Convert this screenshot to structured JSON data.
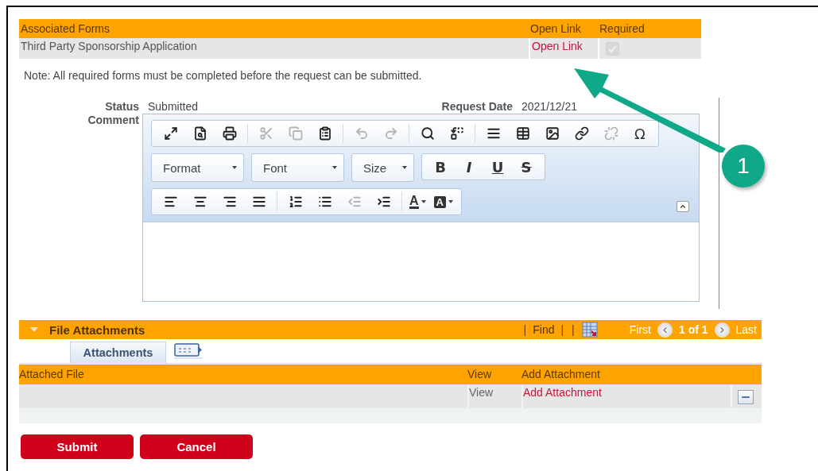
{
  "associated_forms": {
    "columns": [
      "Associated Forms",
      "Open Link",
      "Required"
    ],
    "rows": [
      {
        "name": "Third Party Sponsorship Application",
        "link": "Open Link",
        "required": true,
        "disabled": true
      }
    ]
  },
  "note": "Note: All required forms must be completed before the request can be submitted.",
  "status": {
    "label": "Status",
    "value": "Submitted"
  },
  "request_date": {
    "label": "Request Date",
    "value": "2021/12/21"
  },
  "comment": {
    "label": "Comment",
    "toolbar_rows": [
      [
        {
          "kind": "maximize",
          "disabled": false
        },
        {
          "kind": "preview",
          "disabled": false
        },
        {
          "kind": "print",
          "disabled": false
        },
        {
          "kind": "sep"
        },
        {
          "kind": "cut",
          "disabled": true
        },
        {
          "kind": "copy",
          "disabled": true
        },
        {
          "kind": "paste",
          "disabled": false
        },
        {
          "kind": "sep"
        },
        {
          "kind": "undo",
          "disabled": true
        },
        {
          "kind": "redo",
          "disabled": true
        },
        {
          "kind": "sep"
        },
        {
          "kind": "find",
          "disabled": false
        },
        {
          "kind": "replace",
          "disabled": false
        },
        {
          "kind": "sep"
        },
        {
          "kind": "rule",
          "disabled": false
        },
        {
          "kind": "table",
          "disabled": false
        },
        {
          "kind": "image",
          "disabled": false
        },
        {
          "kind": "link",
          "disabled": false
        },
        {
          "kind": "unlink",
          "disabled": true
        },
        {
          "kind": "glyph",
          "text": "Ω",
          "disabled": false
        }
      ],
      [
        {
          "kind": "combo",
          "text": "Format"
        },
        {
          "kind": "combo",
          "text": "Font"
        },
        {
          "kind": "combo",
          "text": "Size"
        },
        {
          "kind": "bold",
          "text": "B",
          "disabled": false
        },
        {
          "kind": "italic",
          "text": "I",
          "disabled": false
        },
        {
          "kind": "underline",
          "text": "U",
          "disabled": false
        },
        {
          "kind": "strike",
          "text": "S",
          "disabled": false
        }
      ],
      [
        {
          "kind": "align-left",
          "disabled": false
        },
        {
          "kind": "align-center",
          "disabled": false
        },
        {
          "kind": "align-right",
          "disabled": false
        },
        {
          "kind": "justify",
          "disabled": false
        },
        {
          "kind": "sep"
        },
        {
          "kind": "numbered",
          "disabled": false
        },
        {
          "kind": "bulleted",
          "disabled": false
        },
        {
          "kind": "outdent",
          "disabled": true
        },
        {
          "kind": "indent",
          "disabled": false
        },
        {
          "kind": "sep"
        },
        {
          "kind": "text-color",
          "text": "A",
          "disabled": false
        },
        {
          "kind": "back-color",
          "text": "A",
          "disabled": false
        }
      ]
    ]
  },
  "file_attachments": {
    "title": "File Attachments",
    "expanded": true,
    "nav": [
      {
        "kind": "sep",
        "text": "|"
      },
      {
        "kind": "link",
        "text": "Find"
      },
      {
        "kind": "sep",
        "text": "|"
      },
      {
        "kind": "sep",
        "text": "|"
      },
      {
        "kind": "download"
      }
    ],
    "first": "First",
    "page": "1 of 1",
    "last": "Last",
    "tabs": [
      {
        "label": "Attachments",
        "selected": true
      }
    ],
    "columns": [
      "Attached File",
      "View",
      "Add Attachment"
    ],
    "rows": [
      {
        "view": "View",
        "add": "Add Attachment"
      }
    ]
  },
  "buttons": [
    "Submit",
    "Cancel"
  ],
  "callout": {
    "number": "1"
  }
}
